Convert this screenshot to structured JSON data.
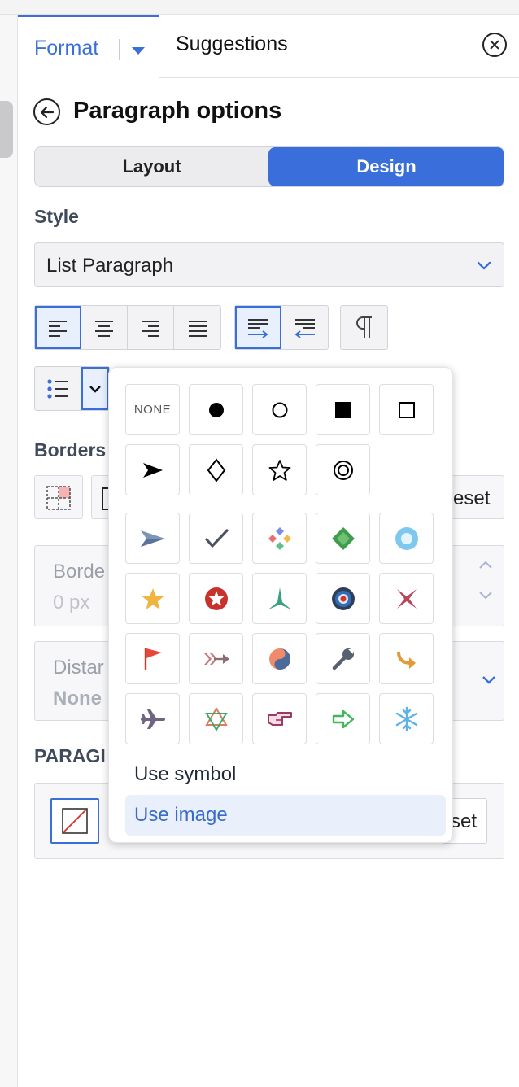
{
  "header": {
    "format_tab": "Format",
    "suggestions_tab": "Suggestions"
  },
  "panel": {
    "title": "Paragraph options",
    "segments": {
      "layout": "Layout",
      "design": "Design"
    }
  },
  "style": {
    "label": "Style",
    "value": "List Paragraph"
  },
  "borders": {
    "label": "Borders",
    "reset_label": "eset",
    "border_width_label": "Borde",
    "border_width_value": "0 px",
    "distance_label": "Distar",
    "distance_value": "None"
  },
  "paragraph_shading": {
    "label": "PARAGI",
    "reset_label": "set"
  },
  "bullet_popup": {
    "none_label": "NONE",
    "basic_symbols": [
      "filled-circle",
      "hollow-circle",
      "filled-square",
      "hollow-square",
      "arrowhead",
      "diamond",
      "star",
      "bullseye"
    ],
    "picture_bullets": [
      "paper-plane",
      "checkmark",
      "four-color-diamonds",
      "green-gem",
      "blue-ring",
      "gold-star",
      "red-star-badge",
      "teal-tristar",
      "target",
      "maltese-cross",
      "red-flag",
      "arrow-with-fletching",
      "yin-yang",
      "wrench",
      "curved-arrow",
      "airplane",
      "star-of-david",
      "pointing-hand",
      "green-arrow",
      "snowflake"
    ],
    "use_symbol": "Use symbol",
    "use_image": "Use image"
  },
  "colors": {
    "accent": "#3a6fdb",
    "selected_bg": "#e9effb"
  }
}
